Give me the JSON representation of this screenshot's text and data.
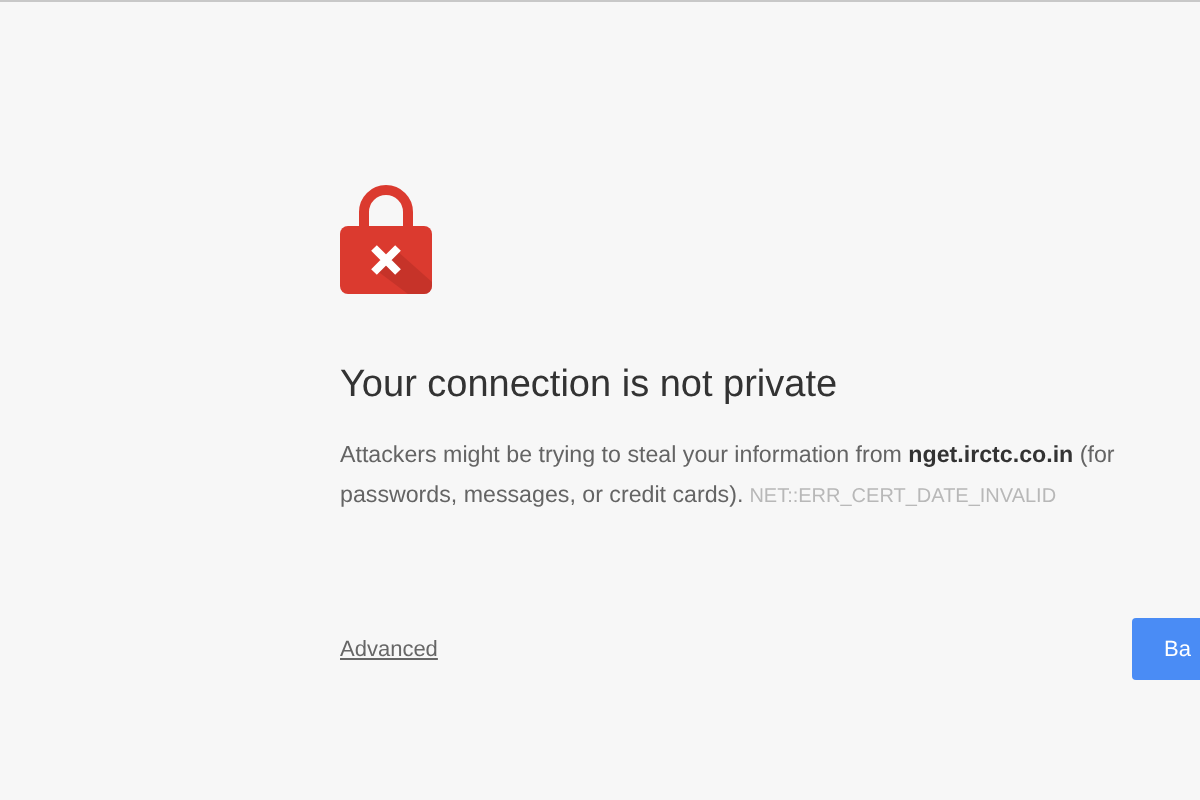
{
  "heading": "Your connection is not private",
  "description": {
    "line_1": "Attackers might be trying to steal your information from **nget.irctc.co.in** (for",
    "line_2": "passwords, messages, or credit cards).",
    "error_code": "NET::ERR_CERT_DATE_INVALID"
  },
  "advanced_link": "Advanced",
  "back_button": "Ba"
}
